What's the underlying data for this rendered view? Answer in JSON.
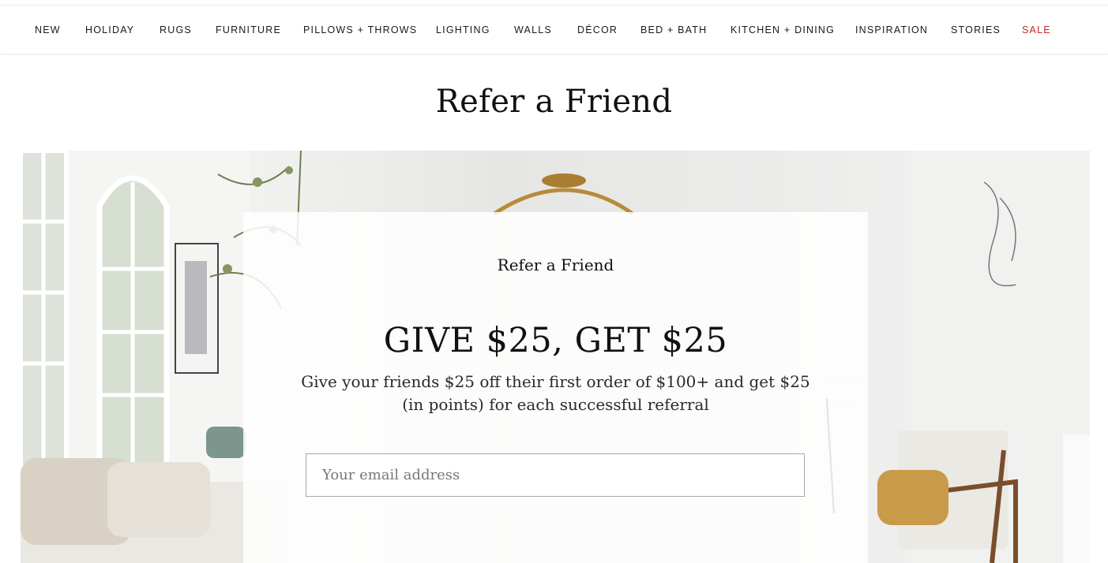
{
  "nav": {
    "items": [
      {
        "label": "NEW"
      },
      {
        "label": "HOLIDAY"
      },
      {
        "label": "RUGS"
      },
      {
        "label": "FURNITURE"
      },
      {
        "label": "PILLOWS + THROWS"
      },
      {
        "label": "LIGHTING"
      },
      {
        "label": "WALLS"
      },
      {
        "label": "DÉCOR"
      },
      {
        "label": "BED + BATH"
      },
      {
        "label": "KITCHEN + DINING"
      },
      {
        "label": "INSPIRATION"
      },
      {
        "label": "STORIES"
      },
      {
        "label": "SALE"
      }
    ]
  },
  "page": {
    "title": "Refer a Friend"
  },
  "referral": {
    "eyebrow": "Refer a Friend",
    "headline": "GIVE $25, GET $25",
    "description": "Give your friends $25 off their first order of $100+ and get $25 (in points) for each successful referral",
    "email_placeholder": "Your email address",
    "email_value": ""
  },
  "colors": {
    "sale": "#c8282b",
    "text": "#111111"
  }
}
